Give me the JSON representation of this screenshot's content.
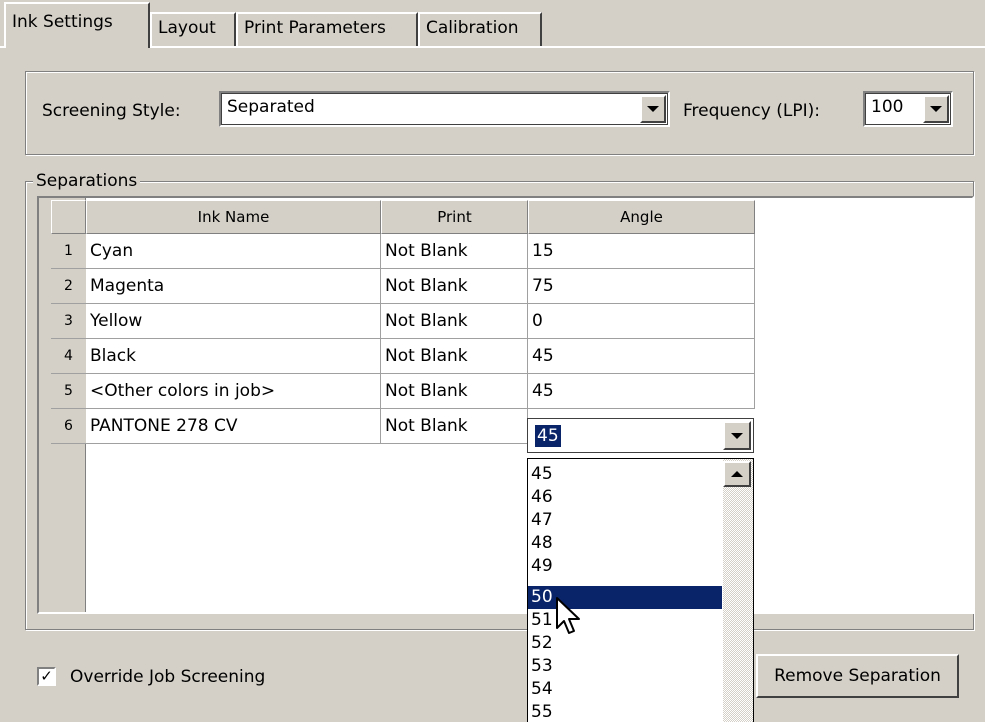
{
  "tabs": [
    {
      "label": "Ink Settings",
      "active": true
    },
    {
      "label": "Layout"
    },
    {
      "label": "Print Parameters"
    },
    {
      "label": "Calibration"
    }
  ],
  "screening": {
    "style_label": "Screening Style:",
    "style_value": "Separated",
    "frequency_label": "Frequency (LPI):",
    "frequency_value": "100"
  },
  "separations": {
    "legend": "Separations",
    "columns": [
      "Ink Name",
      "Print",
      "Angle"
    ],
    "rows": [
      {
        "num": "1",
        "ink": "Cyan",
        "print": "Not Blank",
        "angle": "15"
      },
      {
        "num": "2",
        "ink": "Magenta",
        "print": "Not Blank",
        "angle": "75"
      },
      {
        "num": "3",
        "ink": "Yellow",
        "print": "Not Blank",
        "angle": "0"
      },
      {
        "num": "4",
        "ink": "Black",
        "print": "Not Blank",
        "angle": "45"
      },
      {
        "num": "5",
        "ink": "<Other colors in job>",
        "print": "Not Blank",
        "angle": "45"
      },
      {
        "num": "6",
        "ink": "PANTONE 278 CV",
        "print": "Not Blank",
        "angle": "45"
      }
    ]
  },
  "angle_dropdown": {
    "selected": "45",
    "options": [
      "45",
      "46",
      "47",
      "48",
      "49",
      "50",
      "51",
      "52",
      "53",
      "54",
      "55"
    ],
    "highlighted": "50"
  },
  "bottom": {
    "override_label": "Override Job Screening",
    "override_checked": true,
    "checkmark": "✓",
    "remove_button": "Remove Separation"
  },
  "colors": {
    "face": "#d4d0c8",
    "selection": "#0a246a"
  }
}
